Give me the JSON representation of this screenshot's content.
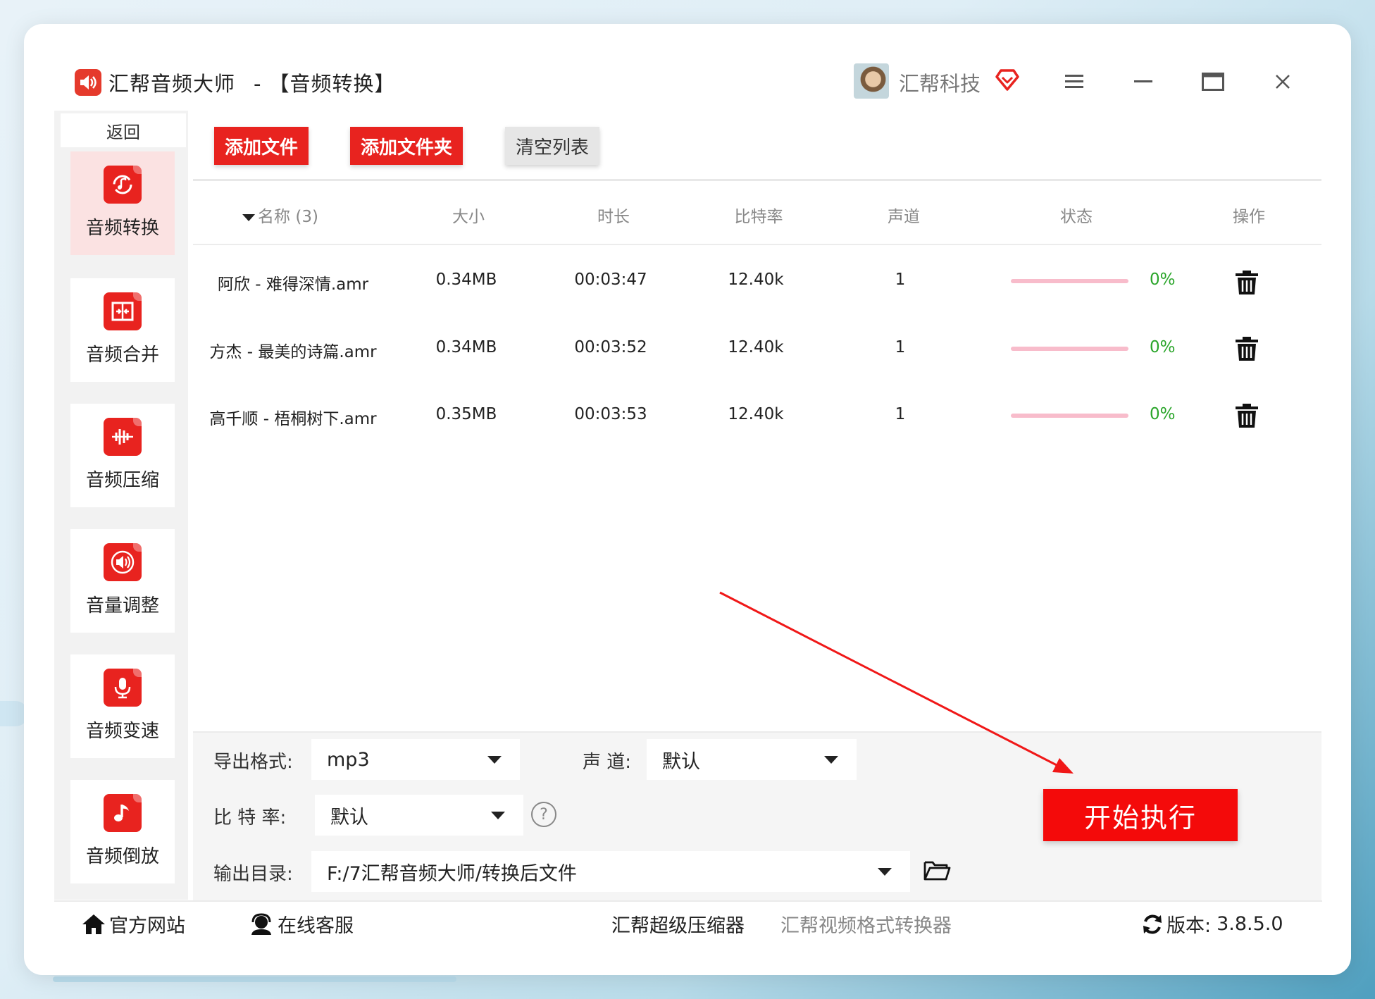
{
  "window": {
    "app_name": "汇帮音频大师",
    "separator": "-",
    "module_title": "【音频转换】",
    "account_name": "汇帮科技"
  },
  "sidebar": {
    "back_label": "返回",
    "items": [
      {
        "label": "音频转换",
        "icon": "audio-convert-icon",
        "active": true
      },
      {
        "label": "音频合并",
        "icon": "audio-merge-icon",
        "active": false
      },
      {
        "label": "音频压缩",
        "icon": "audio-compress-icon",
        "active": false
      },
      {
        "label": "音量调整",
        "icon": "volume-adjust-icon",
        "active": false
      },
      {
        "label": "音频变速",
        "icon": "audio-speed-icon",
        "active": false
      },
      {
        "label": "音频倒放",
        "icon": "audio-reverse-icon",
        "active": false
      }
    ]
  },
  "toolbar": {
    "add_file": "添加文件",
    "add_folder": "添加文件夹",
    "clear_list": "清空列表"
  },
  "table": {
    "headers": {
      "name": "名称 (3)",
      "size": "大小",
      "duration": "时长",
      "bitrate": "比特率",
      "channel": "声道",
      "status": "状态",
      "action": "操作"
    },
    "rows": [
      {
        "name": "阿欣 - 难得深情.amr",
        "size": "0.34MB",
        "duration": "00:03:47",
        "bitrate": "12.40k",
        "channel": "1",
        "progress": "0%"
      },
      {
        "name": "方杰 - 最美的诗篇.amr",
        "size": "0.34MB",
        "duration": "00:03:52",
        "bitrate": "12.40k",
        "channel": "1",
        "progress": "0%"
      },
      {
        "name": "高千顺 - 梧桐树下.amr",
        "size": "0.35MB",
        "duration": "00:03:53",
        "bitrate": "12.40k",
        "channel": "1",
        "progress": "0%"
      }
    ]
  },
  "settings": {
    "format_label": "导出格式:",
    "format_value": "mp3",
    "channel_label": "声 道:",
    "channel_value": "默认",
    "bitrate_label": "比 特 率:",
    "bitrate_value": "默认",
    "help_icon": "?",
    "output_label": "输出目录:",
    "output_value": "F:/7汇帮音频大师/转换后文件"
  },
  "start_button": "开始执行",
  "footer": {
    "official_site": "官方网站",
    "online_service": "在线客服",
    "compressor_link": "汇帮超级压缩器",
    "video_converter_link": "汇帮视频格式转换器",
    "version_label": "版本:",
    "version_value": "3.8.5.0"
  },
  "colors": {
    "accent_red": "#e8231f",
    "progress_track": "#f8bccb",
    "percent_green": "#2aa52a",
    "active_sidebar_bg": "#fbe2e2"
  }
}
